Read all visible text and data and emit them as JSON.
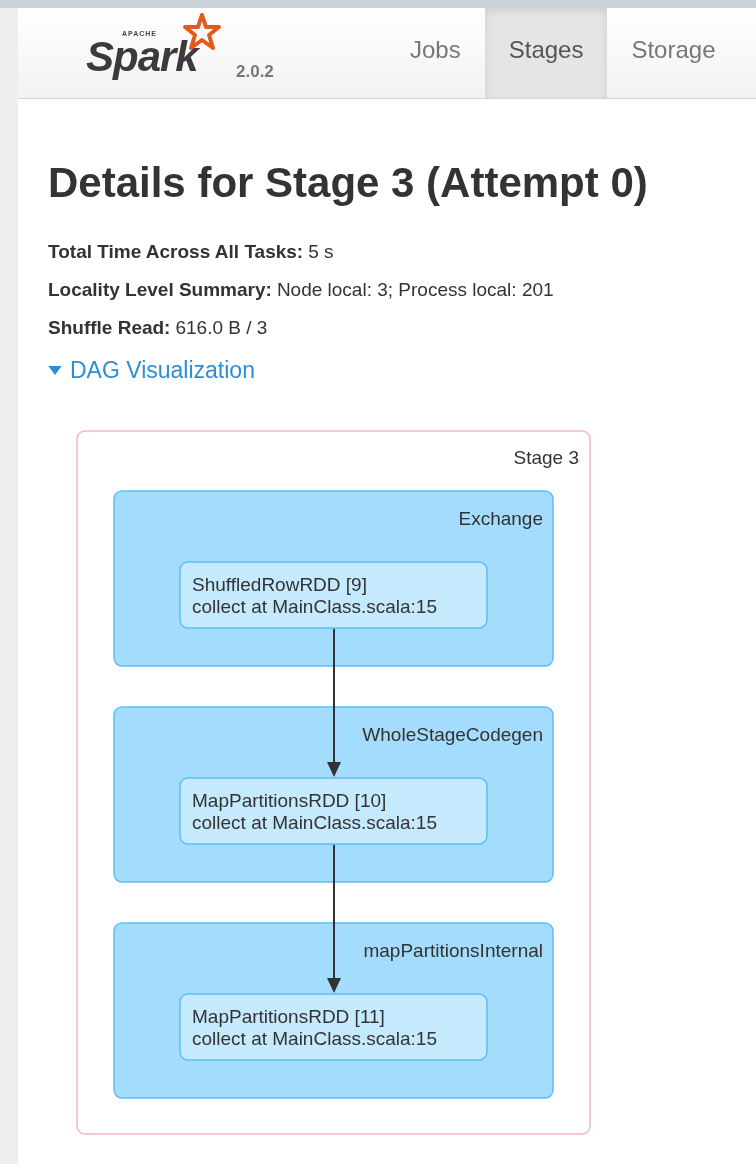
{
  "logo": {
    "small_text": "APACHE",
    "text": "Spark",
    "version": "2.0.2"
  },
  "tabs": [
    {
      "label": "Jobs",
      "selected": false
    },
    {
      "label": "Stages",
      "selected": true
    },
    {
      "label": "Storage",
      "selected": false
    }
  ],
  "title": "Details for Stage 3 (Attempt 0)",
  "summary": [
    {
      "label": "Total Time Across All Tasks:",
      "value": "5 s"
    },
    {
      "label": "Locality Level Summary:",
      "value": "Node local: 3; Process local: 201"
    },
    {
      "label": "Shuffle Read:",
      "value": "616.0 B / 3"
    }
  ],
  "dag_toggle": {
    "label": "DAG Visualization",
    "expanded": true
  },
  "dag": {
    "stage_label": "Stage 3",
    "clusters": [
      {
        "label": "Exchange",
        "node": {
          "name": "ShuffledRowRDD [9]",
          "callsite": "collect at MainClass.scala:15"
        }
      },
      {
        "label": "WholeStageCodegen",
        "node": {
          "name": "MapPartitionsRDD [10]",
          "callsite": "collect at MainClass.scala:15"
        }
      },
      {
        "label": "mapPartitionsInternal",
        "node": {
          "name": "MapPartitionsRDD [11]",
          "callsite": "collect at MainClass.scala:15"
        }
      }
    ]
  }
}
